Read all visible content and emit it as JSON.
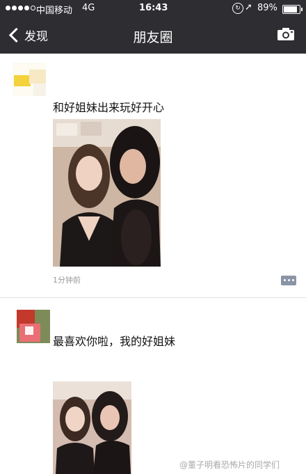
{
  "status_bar": {
    "carrier": "中国移动",
    "network": "4G",
    "time": "16:43",
    "battery": "89%"
  },
  "nav": {
    "back_label": "发现",
    "title": "朋友圈",
    "icons": [
      "back-chevron-icon",
      "camera-icon"
    ]
  },
  "posts": [
    {
      "text": "和好姐妹出来玩好开心",
      "time": "1分钟前",
      "photo": "photo of two women posing together",
      "action_icon": "comment-icon"
    },
    {
      "text": "最喜欢你啦，我的好姐妹",
      "photo": "photo of two women posing together"
    }
  ],
  "watermark": "@董子明看恐怖片的同学们",
  "colors": {
    "nav_bg": "#2e2d32",
    "divider": "#e2e2e2",
    "time_text": "#999999",
    "comment_button": "#8a94a6"
  }
}
